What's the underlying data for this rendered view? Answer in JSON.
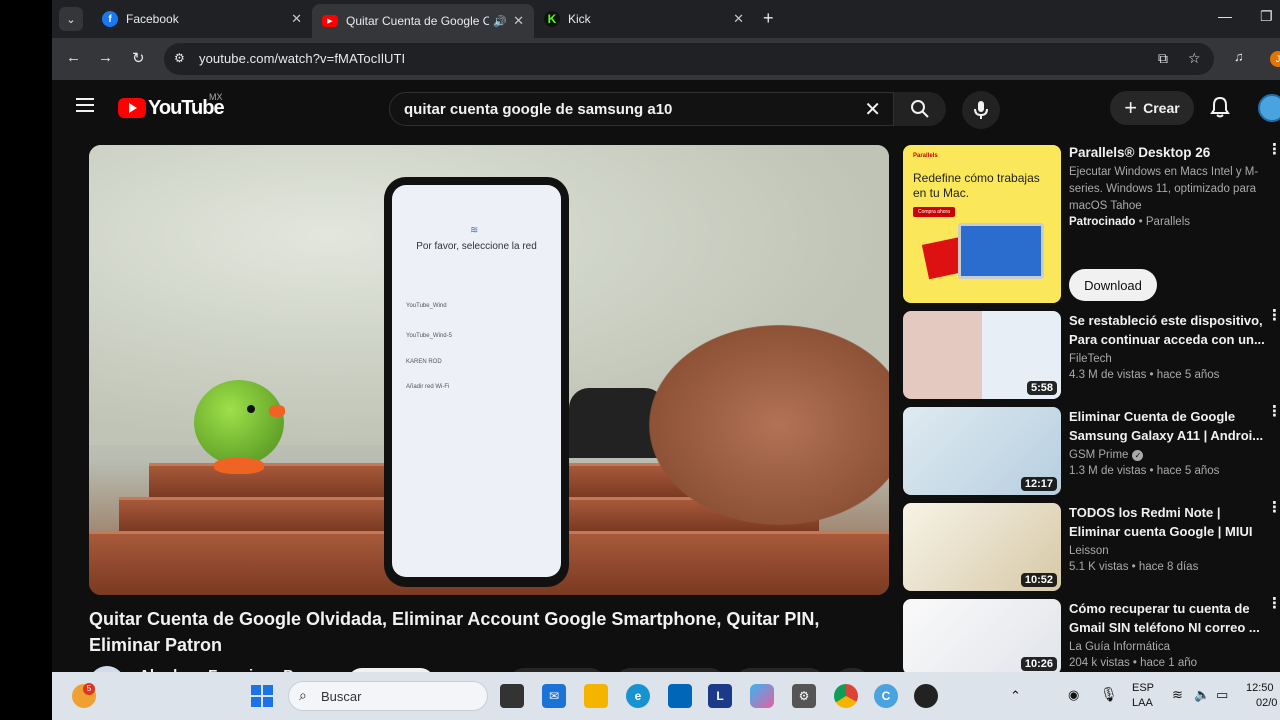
{
  "browser": {
    "tabs": [
      {
        "title": "Facebook",
        "favicon": "facebook-icon",
        "active": false
      },
      {
        "title": "Quitar Cuenta de Google O",
        "favicon": "youtube-icon",
        "active": true,
        "audio": true
      },
      {
        "title": "Kick",
        "favicon": "kick-icon",
        "active": false
      }
    ],
    "url": "youtube.com/watch?v=fMATocIlUTI"
  },
  "youtube": {
    "logo_text": "YouTube",
    "country_code": "MX",
    "search_value": "quitar cuenta google de samsung a10",
    "create_label": "Crear"
  },
  "video": {
    "screen_title": "Por favor, seleccione la red",
    "networks": [
      "YouTube_Wind",
      "YouTube_Wind-5",
      "KAREN ROD",
      "Añadir red Wi-Fi"
    ],
    "title": "Quitar Cuenta de Google Olvidada, Eliminar Account Google Smartphone, Quitar PIN, Eliminar Patron",
    "channel": "Abraham Francisco Pons"
  },
  "sidebar": {
    "ad": {
      "title": "Parallels® Desktop 26",
      "description": "Ejecutar Windows en Macs Intel y M-series. Windows 11, optimizado para macOS Tahoe",
      "sponsor_label": "Patrocinado",
      "sponsor": "Parallels",
      "thumb_brand": "Parallels",
      "thumb_headline": "Redefine cómo trabajas en tu Mac.",
      "thumb_cta": "Compra ahora",
      "button": "Download"
    },
    "videos": [
      {
        "title": "Se restableció este dispositivo, Para continuar acceda con un...",
        "channel": "FileTech",
        "stats": "4.3 M de vistas • hace 5 años",
        "duration": "5:58",
        "thumb_color": "#c9d7e8",
        "verified": false
      },
      {
        "title": "Eliminar Cuenta de Google Samsung Galaxy A11 | Androi...",
        "channel": "GSM Prime",
        "stats": "1.3 M de vistas • hace 5 años",
        "duration": "12:17",
        "thumb_color": "#d9e6ef",
        "verified": true
      },
      {
        "title": "TODOS los Redmi Note | Eliminar cuenta Google | MIUI ...",
        "channel": "Leisson",
        "stats": "5.1 K vistas • hace 8 días",
        "duration": "10:52",
        "thumb_color": "#f3f0e6",
        "verified": false
      },
      {
        "title": "Cómo recuperar tu cuenta de Gmail SIN teléfono NI correo ...",
        "channel": "La Guía Informática",
        "stats": "204 k vistas • hace 1 año",
        "duration": "10:26",
        "thumb_color": "#f5f5f5",
        "verified": false
      }
    ]
  },
  "taskbar": {
    "search_label": "Buscar",
    "weather_badge": "5",
    "lang_top": "ESP",
    "lang_bottom": "LAA",
    "time": "12:50",
    "date": "02/0"
  }
}
